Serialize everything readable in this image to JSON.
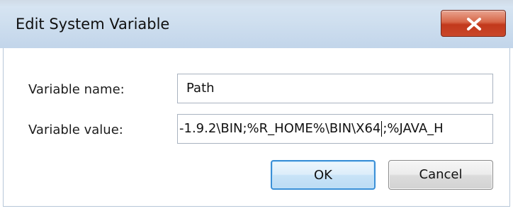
{
  "window": {
    "title": "Edit System Variable",
    "close_icon": "close-icon"
  },
  "form": {
    "name_label": "Variable name:",
    "name_value": "Path",
    "value_label": "Variable value:",
    "value_before_caret": "-1.9.2\\BIN;%R_HOME%\\BIN\\X64",
    "value_after_caret": ";%JAVA_H"
  },
  "buttons": {
    "ok_label": "OK",
    "cancel_label": "Cancel"
  },
  "colors": {
    "close_button": "#c9472a",
    "ok_border": "#3b8fd6",
    "titlebar": "#cfdfef"
  }
}
